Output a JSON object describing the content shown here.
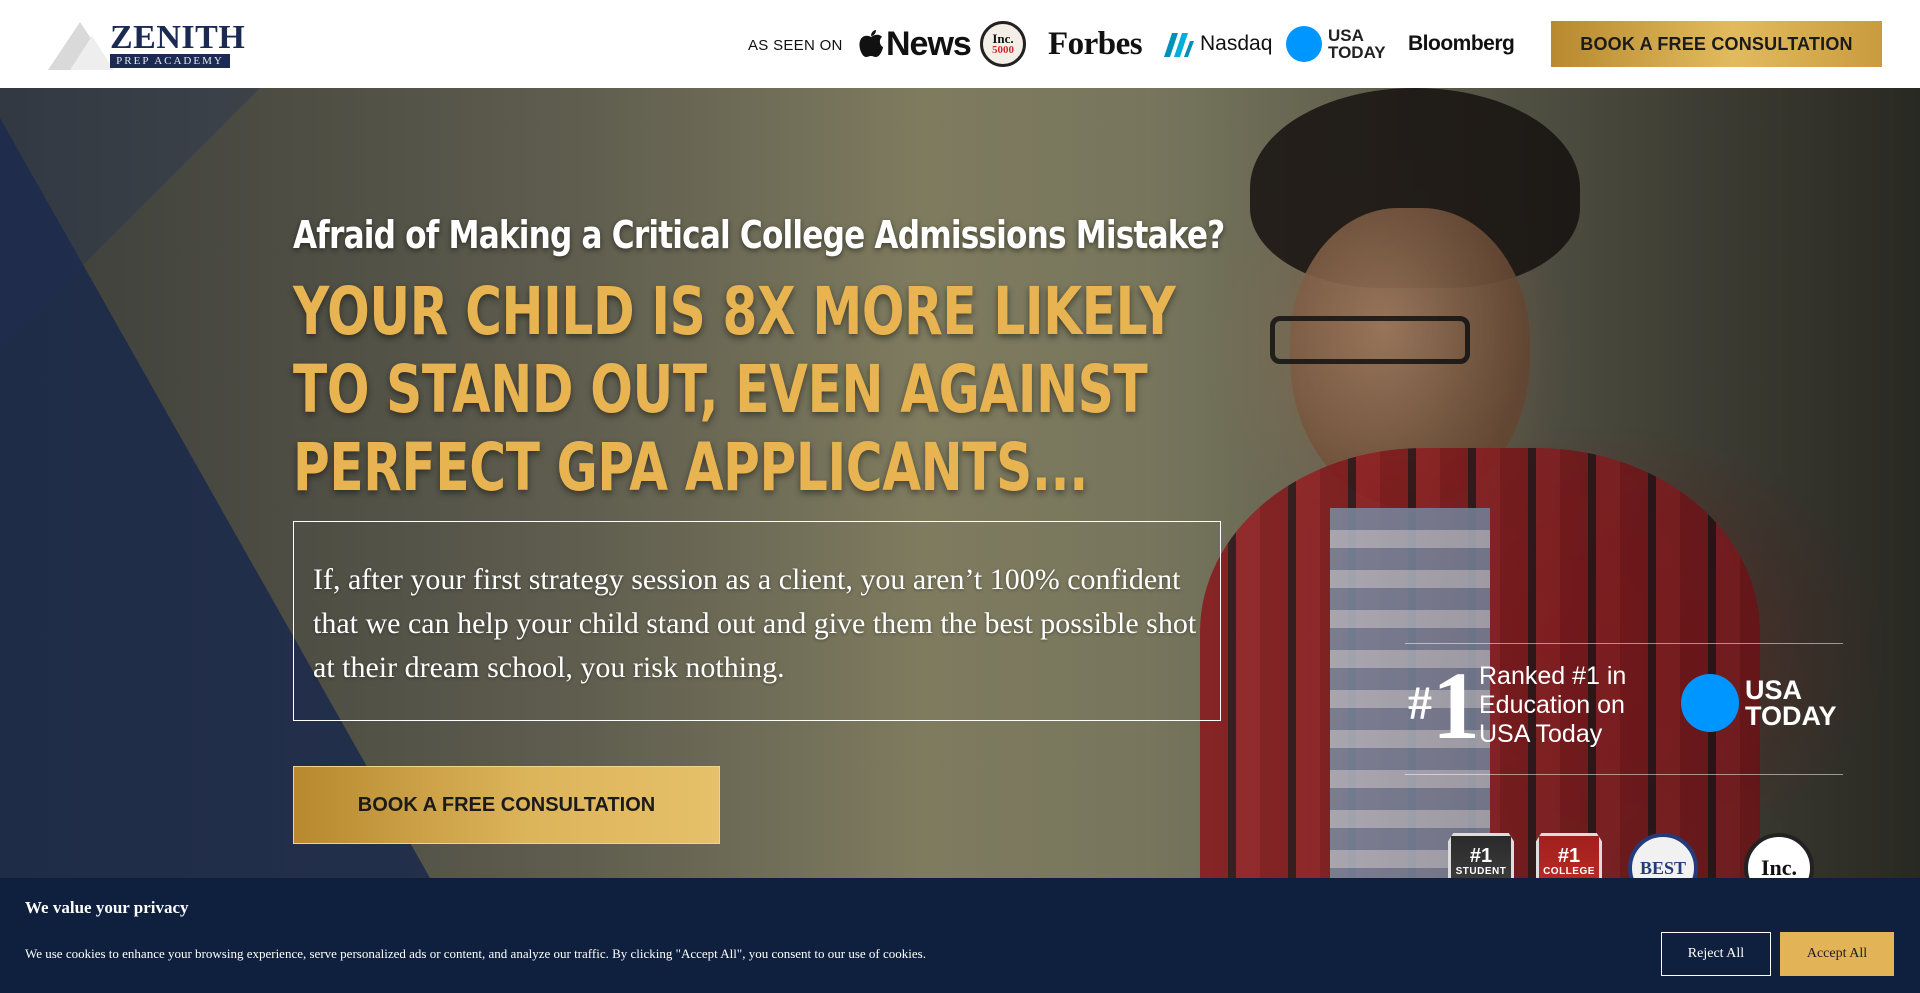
{
  "header": {
    "logo": {
      "brand": "ZENITH",
      "sub": "PREP ACADEMY"
    },
    "as_seen_on": "AS SEEN ON",
    "press": {
      "apple_news": "News",
      "inc": {
        "line1": "Inc.",
        "line2": "5000"
      },
      "forbes": "Forbes",
      "nasdaq": "Nasdaq",
      "usa_today": {
        "line1": "USA",
        "line2": "TODAY"
      },
      "bloomberg": "Bloomberg"
    },
    "cta": "BOOK A FREE CONSULTATION"
  },
  "hero": {
    "subheadline": "Afraid of Making a Critical College Admissions Mistake?",
    "headline": "YOUR CHILD IS 8X MORE LIKELY TO STAND OUT, EVEN AGAINST PERFECT GPA APPLICANTS...",
    "guarantee": "If, after your first strategy session as a client, you aren’t 100% confident that we can help your child stand out and give them the best possible shot at their dream school, you risk nothing.",
    "cta": "BOOK A FREE CONSULTATION",
    "ranking": {
      "hash": "#",
      "number": "1",
      "line1": "Ranked #1 in",
      "line2": "Education on",
      "line3": "USA Today",
      "usa_today": {
        "line1": "USA",
        "line2": "TODAY"
      }
    },
    "badges": [
      {
        "big": "#1",
        "small": "STUDENT"
      },
      {
        "big": "#1",
        "small": "COLLEGE"
      },
      {
        "label": "BEST"
      },
      {
        "label": "Inc."
      }
    ]
  },
  "cookie": {
    "title": "We value your privacy",
    "text": "We use cookies to enhance your browsing experience, serve personalized ads or content, and analyze our traffic. By clicking \"Accept All\", you consent to our use of cookies.",
    "reject": "Reject All",
    "accept": "Accept All"
  },
  "colors": {
    "navy": "#1b2a52",
    "gold": "#e8b451",
    "usa_blue": "#0096ff",
    "cookie_bg": "#0f1f3e"
  }
}
